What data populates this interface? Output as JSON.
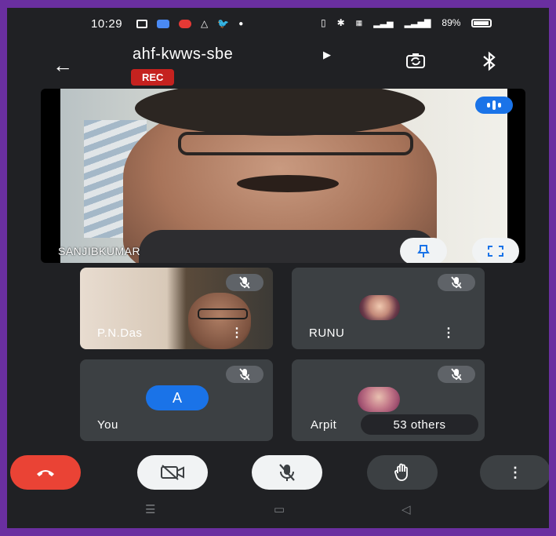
{
  "status": {
    "time": "10:29",
    "battery": "89%"
  },
  "topbar": {
    "meeting_code": "ahf-kwws-sbe",
    "rec": "REC"
  },
  "main": {
    "speaker_name": "SANJIBKUMAR"
  },
  "tiles": [
    {
      "name": "P.N.Das"
    },
    {
      "name": "RUNU"
    },
    {
      "name": "You",
      "avatar_letter": "A"
    },
    {
      "name": "Arpit",
      "others": "53 others"
    }
  ],
  "colors": {
    "end_call": "#ea4335",
    "accent": "#1a73e8",
    "rec": "#c5221f",
    "border": "#6a2fa0"
  }
}
